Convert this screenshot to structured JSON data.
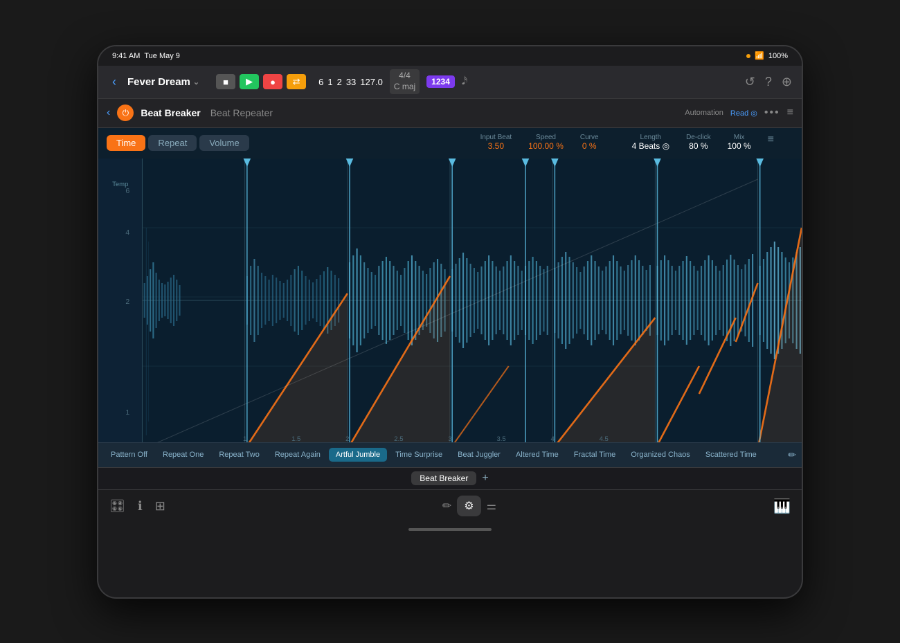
{
  "status": {
    "time": "9:41 AM",
    "date": "Tue May 9",
    "wifi": "100%",
    "battery": "100%"
  },
  "transport": {
    "back_label": "‹",
    "project_title": "Fever Dream",
    "chevron": "⌄",
    "stop_icon": "■",
    "play_icon": "▶",
    "record_icon": "●",
    "loop_icon": "⇄",
    "position": {
      "bar": "6",
      "beat": "1",
      "sub": "2",
      "tick": "33",
      "bpm": "127.0"
    },
    "time_sig_top": "4/4",
    "time_sig_bottom": "C maj",
    "scene": "1234",
    "metronome": "🔔",
    "right_icons": [
      "⏮",
      "?",
      "⊕"
    ]
  },
  "plugin_header": {
    "back": "‹",
    "power": "⏻",
    "name": "Beat Breaker",
    "subtitle": "Beat Repeater",
    "automation_label": "Automation",
    "automation_value": "Read ◎",
    "more": "•••",
    "hamburger": "≡"
  },
  "tabs": {
    "items": [
      "Time",
      "Repeat",
      "Volume"
    ],
    "active": 0
  },
  "params": {
    "input_beat": {
      "label": "Input Beat",
      "value": "3.50"
    },
    "speed": {
      "label": "Speed",
      "value": "100.00 %"
    },
    "curve": {
      "label": "Curve",
      "value": "0 %"
    },
    "length": {
      "label": "Length",
      "value": "4 Beats ◎"
    },
    "de_click": {
      "label": "De-click",
      "value": "80 %"
    },
    "mix": {
      "label": "Mix",
      "value": "100 %"
    }
  },
  "waveform": {
    "y_labels": [
      "6",
      "4",
      "2",
      "1"
    ],
    "x_labels": [
      "1",
      "1.5",
      "2",
      "2.5",
      "3",
      "3.5",
      "4",
      "4.5"
    ]
  },
  "patterns": {
    "items": [
      {
        "label": "Pattern Off",
        "active": false
      },
      {
        "label": "Repeat One",
        "active": false
      },
      {
        "label": "Repeat Two",
        "active": false
      },
      {
        "label": "Repeat Again",
        "active": false
      },
      {
        "label": "Artful Jumble",
        "active": true
      },
      {
        "label": "Time Surprise",
        "active": false
      },
      {
        "label": "Beat Juggler",
        "active": false
      },
      {
        "label": "Altered Time",
        "active": false
      },
      {
        "label": "Fractal Time",
        "active": false
      },
      {
        "label": "Organized Chaos",
        "active": false
      },
      {
        "label": "Scattered Time",
        "active": false
      }
    ],
    "edit_icon": "✏"
  },
  "bottom_bar": {
    "plugin_chip": "Beat Breaker",
    "add_icon": "+"
  },
  "toolbar": {
    "left_icons": [
      "🎛",
      "ℹ",
      "⊞"
    ],
    "pencil": "✏",
    "gear": "⚙",
    "sliders": "⚌",
    "piano": "🎹"
  }
}
